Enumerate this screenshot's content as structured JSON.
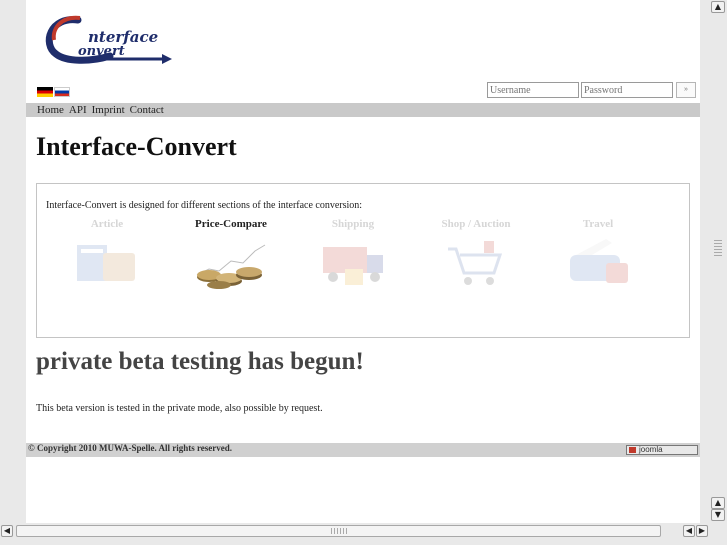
{
  "logo": {
    "word1": "nterface",
    "word2": "onvert"
  },
  "language_flags": [
    {
      "name": "german-flag-icon"
    },
    {
      "name": "russian-flag-icon"
    }
  ],
  "login": {
    "username_placeholder": "Username",
    "password_placeholder": "Password",
    "submit_label": "»"
  },
  "nav": [
    "Home",
    "API",
    "Imprint",
    "Contact"
  ],
  "page_title": "Interface-Convert",
  "intro": "Interface-Convert is designed for different sections of the interface conversion:",
  "categories": [
    {
      "label": "Article",
      "active": false
    },
    {
      "label": "Price-Compare",
      "active": true
    },
    {
      "label": "Shipping",
      "active": false
    },
    {
      "label": "Shop / Auction",
      "active": false
    },
    {
      "label": "Travel",
      "active": false
    }
  ],
  "announcement": "private beta testing has begun!",
  "info": "This beta version is tested in the private mode, also possible by request.",
  "footer": {
    "copyright": "© Copyright 2010 MUWA-Spelle. All rights reserved.",
    "badge": "joomla"
  },
  "colors": {
    "logo_red": "#c0392b",
    "logo_navy": "#1f2d6b",
    "nav_bg": "#c9c9c9",
    "footer_bg": "#d0d0d0"
  }
}
